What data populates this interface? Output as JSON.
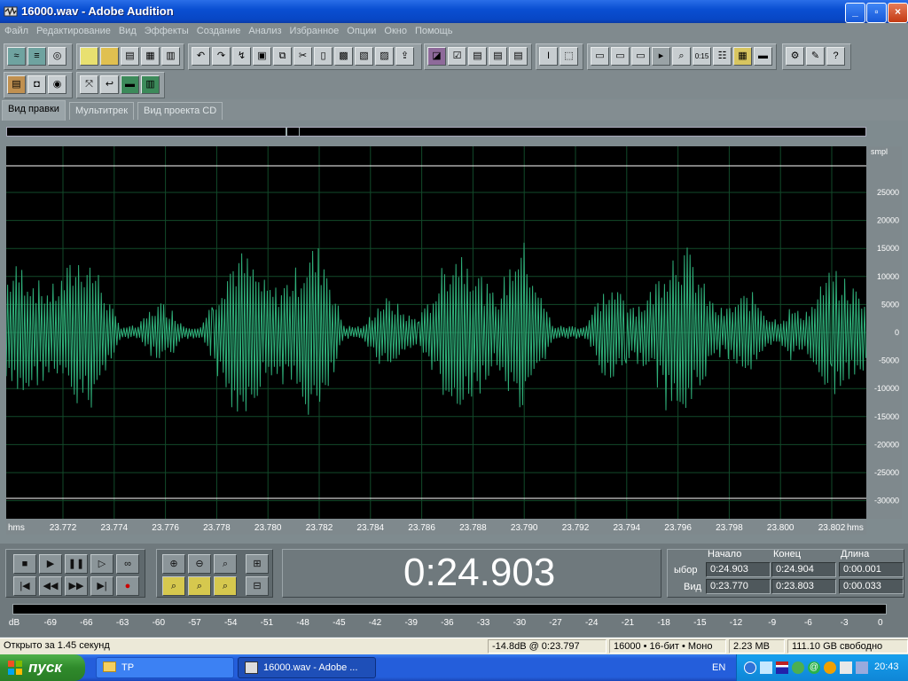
{
  "window": {
    "title": "16000.wav - Adobe Audition",
    "controls": [
      "_",
      "▫",
      "×"
    ]
  },
  "menu": [
    "Файл",
    "Редактирование",
    "Вид",
    "Эффекты",
    "Создание",
    "Анализ",
    "Избранное",
    "Опции",
    "Окно",
    "Помощь"
  ],
  "view_tabs": [
    {
      "label": "Вид правки",
      "active": true
    },
    {
      "label": "Мультитрек",
      "active": false
    },
    {
      "label": "Вид проекта CD",
      "active": false
    }
  ],
  "waveform": {
    "waveform_color": "#2fb07a",
    "background_color": "#000000",
    "grid_color": "#124a2a",
    "y_axis_unit": "smpl",
    "y_ticks": [
      25000,
      20000,
      15000,
      10000,
      5000,
      0,
      -5000,
      -10000,
      -15000,
      -20000,
      -25000,
      -30000
    ],
    "x_axis_unit": "hms",
    "x_ticks": [
      "23.772",
      "23.774",
      "23.776",
      "23.778",
      "23.780",
      "23.782",
      "23.784",
      "23.786",
      "23.788",
      "23.790",
      "23.792",
      "23.794",
      "23.796",
      "23.798",
      "23.800",
      "23.802"
    ]
  },
  "transport": {
    "buttons": [
      "stop-icon",
      "play-icon",
      "pause-icon",
      "play-to-end-icon",
      "loop-icon",
      "go-start-icon",
      "rewind-icon",
      "fast-forward-icon",
      "go-end-icon",
      "record-icon"
    ],
    "zoom_buttons": [
      "zoom-in-h-icon",
      "zoom-out-h-icon",
      "zoom-full-icon",
      "zoom-in-v-icon",
      "zoom-sel-icon",
      "zoom-left-icon",
      "zoom-right-icon",
      "zoom-out-v-icon"
    ],
    "time_display": "0:24.903"
  },
  "selection": {
    "headers": {
      "start": "Начало",
      "end": "Конец",
      "length": "Длина"
    },
    "rows": [
      {
        "label": "ыбор",
        "start": "0:24.903",
        "end": "0:24.904",
        "length": "0:00.001"
      },
      {
        "label": "Вид",
        "start": "0:23.770",
        "end": "0:23.803",
        "length": "0:00.033"
      }
    ]
  },
  "level_meter": {
    "labels": [
      "dB",
      "-69",
      "-66",
      "-63",
      "-60",
      "-57",
      "-54",
      "-51",
      "-48",
      "-45",
      "-42",
      "-39",
      "-36",
      "-33",
      "-30",
      "-27",
      "-24",
      "-21",
      "-18",
      "-15",
      "-12",
      "-9",
      "-6",
      "-3",
      "0"
    ]
  },
  "status": {
    "opened": "Открыто за 1.45 секунд",
    "level": "-14.8dB @  0:23.797",
    "format": "16000 • 16-бит • Моно",
    "size": "2.23 MB",
    "free": "111.10 GB свободно"
  },
  "taskbar": {
    "start_label": "пуск",
    "tasks": [
      {
        "label": "TP",
        "icon": "folder-icon",
        "active": false
      },
      {
        "label": "16000.wav - Adobe ...",
        "icon": "audition-icon",
        "active": true
      }
    ],
    "tray": {
      "lang": "EN",
      "clock": "20:43"
    }
  },
  "colors": {
    "titlebar": "#0a4fd2",
    "app_chrome": "#808a8e",
    "waveform": "#2fb07a"
  }
}
